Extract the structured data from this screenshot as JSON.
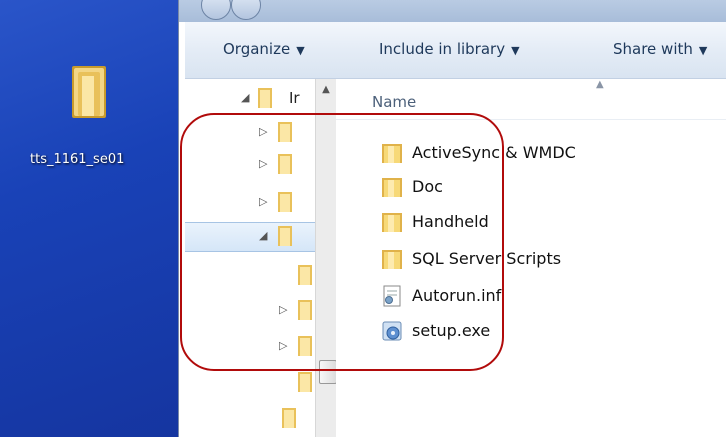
{
  "desktop": {
    "icon_label": "tts_1161_se01",
    "icon_name": "folder-icon"
  },
  "toolbar": {
    "organize": "Organize",
    "include_in_library": "Include in library",
    "share_with": "Share with"
  },
  "nav": {
    "top_item_label": "Ir"
  },
  "content": {
    "column_header": "Name",
    "files": [
      {
        "name": "ActiveSync & WMDC",
        "icon": "folder-icon"
      },
      {
        "name": "Doc",
        "icon": "folder-icon"
      },
      {
        "name": "Handheld",
        "icon": "folder-icon"
      },
      {
        "name": "SQL Server Scripts",
        "icon": "folder-icon"
      },
      {
        "name": "Autorun.inf",
        "icon": "settings-file-icon"
      },
      {
        "name": "setup.exe",
        "icon": "installer-icon"
      }
    ]
  },
  "colors": {
    "desktop_blue": "#1942b7",
    "highlight_red": "#b10b0b",
    "toolbar_text": "#1e395b"
  }
}
